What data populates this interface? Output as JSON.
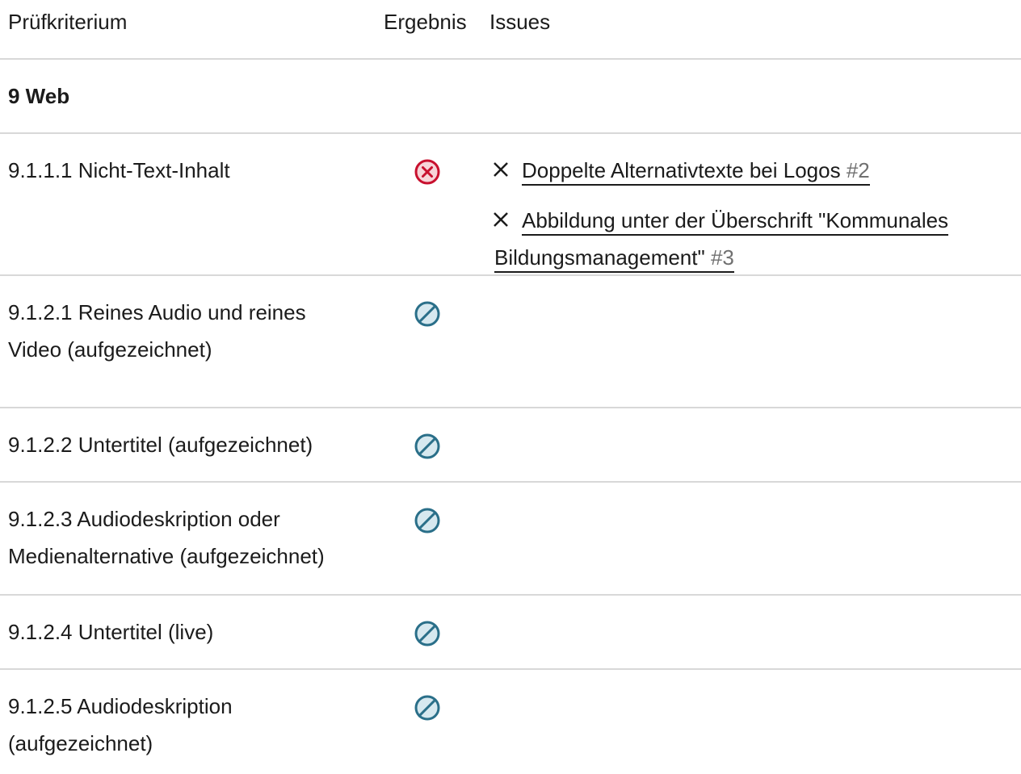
{
  "header": {
    "criterion": "Prüfkriterium",
    "result": "Ergebnis",
    "issues": "Issues"
  },
  "section": {
    "title": "9 Web"
  },
  "colors": {
    "fail": "#c8102e",
    "not_applicable": "#2a6f89",
    "not_applicable_fill": "#d6e8ef",
    "fail_fill": "#f7d4d8",
    "divider": "#d8d8d8"
  },
  "rows": [
    {
      "criterion": "9.1.1.1 Nicht-Text-Inhalt",
      "result_icon": "fail-icon",
      "issues": [
        {
          "title": "Doppelte Alternativtexte bei Logos",
          "number": "#2"
        },
        {
          "title_line1": "Abbildung unter der Überschrift \"Kommunales",
          "title_line2": "Bildungsmanagement\"",
          "number": "#3"
        }
      ]
    },
    {
      "criterion_line1": "9.1.2.1 Reines Audio und reines",
      "criterion_line2": "Video (aufgezeichnet)",
      "result_icon": "not-applicable-icon"
    },
    {
      "criterion": "9.1.2.2 Untertitel (aufgezeichnet)",
      "result_icon": "not-applicable-icon"
    },
    {
      "criterion_line1": "9.1.2.3 Audiodeskription oder",
      "criterion_line2": "Medienalternative (aufgezeichnet)",
      "result_icon": "not-applicable-icon"
    },
    {
      "criterion": "9.1.2.4 Untertitel (live)",
      "result_icon": "not-applicable-icon"
    },
    {
      "criterion_line1": "9.1.2.5 Audiodeskription",
      "criterion_line2": "(aufgezeichnet)",
      "result_icon": "not-applicable-icon"
    }
  ]
}
